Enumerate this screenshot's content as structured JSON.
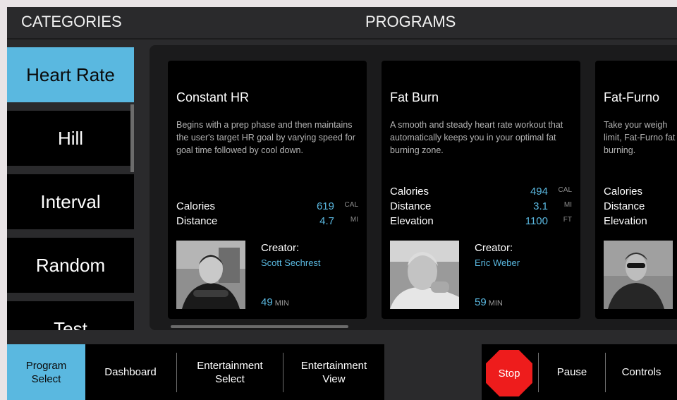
{
  "header": {
    "categories_title": "CATEGORIES",
    "programs_title": "PROGRAMS"
  },
  "categories": [
    {
      "label": "Heart Rate",
      "selected": true
    },
    {
      "label": "Hill",
      "selected": false
    },
    {
      "label": "Interval",
      "selected": false
    },
    {
      "label": "Random",
      "selected": false
    },
    {
      "label": "Test",
      "selected": false
    }
  ],
  "programs": [
    {
      "title": "Constant HR",
      "description": "Begins with a prep phase and then maintains the user's target HR goal by varying speed for goal time followed by cool down.",
      "stats": [
        {
          "label": "Calories",
          "value": "619",
          "unit": "CAL"
        },
        {
          "label": "Distance",
          "value": "4.7",
          "unit": "MI"
        }
      ],
      "creator_label": "Creator:",
      "creator_name": "Scott Sechrest",
      "duration": "49",
      "duration_unit": "MIN"
    },
    {
      "title": "Fat Burn",
      "description": "A smooth and steady heart rate workout that automatically keeps you in your optimal fat burning zone.",
      "stats": [
        {
          "label": "Calories",
          "value": "494",
          "unit": "CAL"
        },
        {
          "label": "Distance",
          "value": "3.1",
          "unit": "MI"
        },
        {
          "label": "Elevation",
          "value": "1100",
          "unit": "FT"
        }
      ],
      "creator_label": "Creator:",
      "creator_name": "Eric Weber",
      "duration": "59",
      "duration_unit": "MIN"
    },
    {
      "title": "Fat-Furno",
      "description": "Take your weigh limit, Fat-Furno fat burning.",
      "stats": [
        {
          "label": "Calories"
        },
        {
          "label": "Distance"
        },
        {
          "label": "Elevation"
        }
      ]
    }
  ],
  "nav": {
    "program_select": "Program\nSelect",
    "dashboard": "Dashboard",
    "entertainment_select": "Entertainment\nSelect",
    "entertainment_view": "Entertainment\nView",
    "stop": "Stop",
    "pause": "Pause",
    "controls": "Controls"
  },
  "colors": {
    "accent": "#5ab8e0",
    "stop": "#ee1c1c",
    "background": "#2a2a2c",
    "card": "#000000"
  },
  "icons": {
    "stop_button": "stop-sign-icon"
  }
}
